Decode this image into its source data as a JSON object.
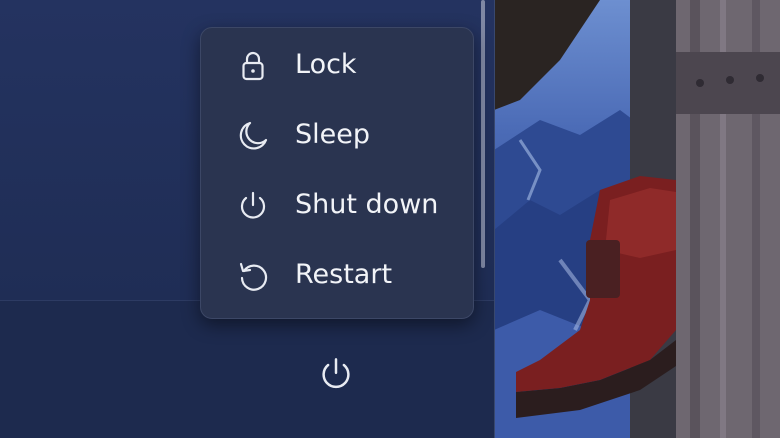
{
  "power_menu": {
    "items": [
      {
        "label": "Lock",
        "icon": "lock-icon"
      },
      {
        "label": "Sleep",
        "icon": "moon-icon"
      },
      {
        "label": "Shut down",
        "icon": "power-icon"
      },
      {
        "label": "Restart",
        "icon": "restart-icon"
      }
    ]
  },
  "footer": {
    "power_button_icon": "power-icon"
  },
  "colors": {
    "panel": "#223055",
    "flyout": "#2a3450",
    "text": "#f2f4f8",
    "icon": "#e8ebf2"
  }
}
